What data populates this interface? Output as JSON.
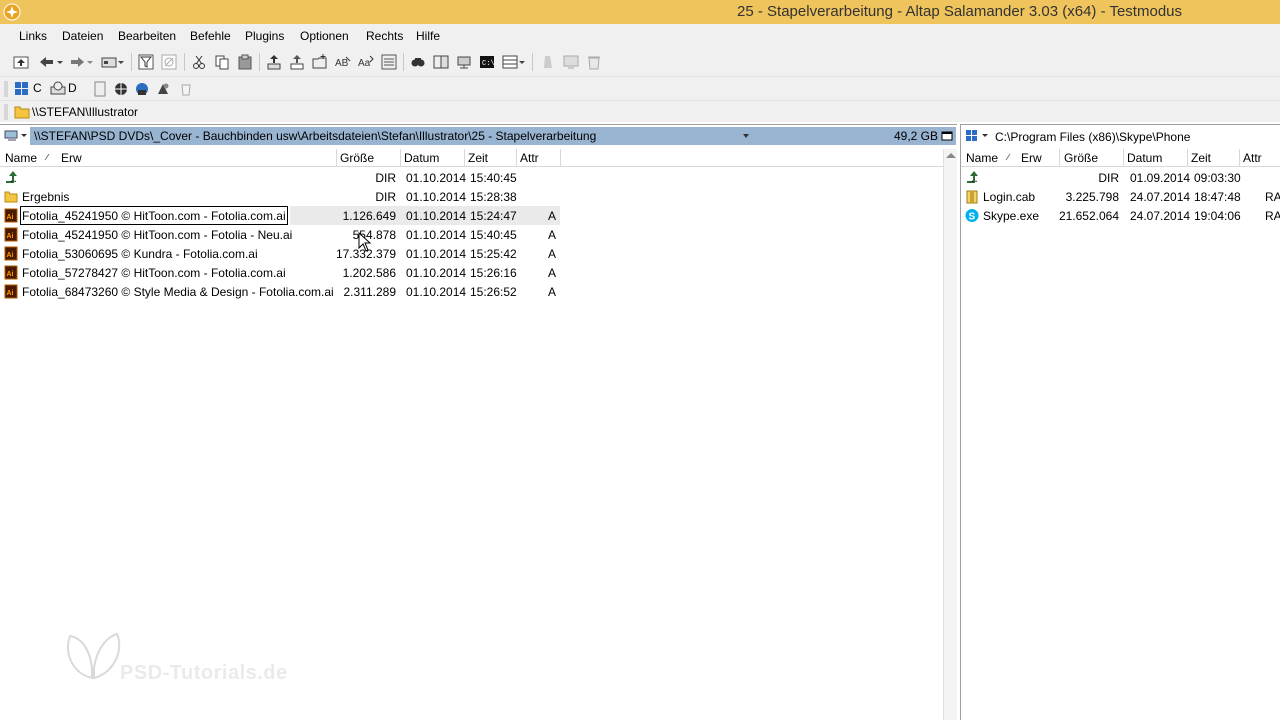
{
  "window": {
    "title": "25 - Stapelverarbeitung - Altap Salamander 3.03 (x64) - Testmodus"
  },
  "menu": {
    "items": [
      {
        "label": "Links"
      },
      {
        "label": "Dateien"
      },
      {
        "label": "Bearbeiten"
      },
      {
        "label": "Befehle"
      },
      {
        "label": "Plugins"
      },
      {
        "label": "Optionen"
      },
      {
        "label": "Rechts"
      },
      {
        "label": "Hilfe"
      }
    ]
  },
  "drives": {
    "c": "C",
    "d": "D"
  },
  "hotpath": {
    "label": "\\\\STEFAN\\Illustrator"
  },
  "left_panel": {
    "path": "\\\\STEFAN\\PSD DVDs\\_Cover - Bauchbinden usw\\Arbeitsdateien\\Stefan\\Illustrator\\25 - Stapelverarbeitung",
    "free_space": "49,2 GB",
    "columns": {
      "name": "Name",
      "ext": "Erw",
      "size": "Größe",
      "date": "Datum",
      "time": "Zeit",
      "attr": "Attr"
    },
    "rows": [
      {
        "name": "..",
        "size": "DIR",
        "date": "01.10.2014",
        "time": "15:40:45",
        "attr": "",
        "icon": "up-dir-icon"
      },
      {
        "name": "Ergebnis",
        "size": "DIR",
        "date": "01.10.2014",
        "time": "15:28:38",
        "attr": "",
        "icon": "folder-icon"
      },
      {
        "name": "Fotolia_45241950 © HitToon.com - Fotolia.com.ai",
        "size": "1.126.649",
        "date": "01.10.2014",
        "time": "15:24:47",
        "attr": "A",
        "icon": "illustrator-file-icon"
      },
      {
        "name": "Fotolia_45241950 © HitToon.com - Fotolia - Neu.ai",
        "size": "554.878",
        "date": "01.10.2014",
        "time": "15:40:45",
        "attr": "A",
        "icon": "illustrator-file-icon"
      },
      {
        "name": "Fotolia_53060695 © Kundra - Fotolia.com.ai",
        "size": "17.332.379",
        "date": "01.10.2014",
        "time": "15:25:42",
        "attr": "A",
        "icon": "illustrator-file-icon"
      },
      {
        "name": "Fotolia_57278427 © HitToon.com - Fotolia.com.ai",
        "size": "1.202.586",
        "date": "01.10.2014",
        "time": "15:26:16",
        "attr": "A",
        "icon": "illustrator-file-icon"
      },
      {
        "name": "Fotolia_68473260 © Style Media & Design - Fotolia.com.ai",
        "size": "2.311.289",
        "date": "01.10.2014",
        "time": "15:26:52",
        "attr": "A",
        "icon": "illustrator-file-icon"
      }
    ]
  },
  "right_panel": {
    "path": "C:\\Program Files (x86)\\Skype\\Phone",
    "columns": {
      "name": "Name",
      "ext": "Erw",
      "size": "Größe",
      "date": "Datum",
      "time": "Zeit",
      "attr": "Attr"
    },
    "rows": [
      {
        "name": "..",
        "size": "DIR",
        "date": "01.09.2014",
        "time": "09:03:30",
        "attr": "",
        "icon": "up-dir-icon"
      },
      {
        "name": "Login.cab",
        "size": "3.225.798",
        "date": "24.07.2014",
        "time": "18:47:48",
        "attr": "RA",
        "icon": "cab-file-icon"
      },
      {
        "name": "Skype.exe",
        "size": "21.652.064",
        "date": "24.07.2014",
        "time": "19:04:06",
        "attr": "RA",
        "icon": "skype-icon"
      }
    ]
  },
  "watermark": {
    "text": "PSD-Tutorials.de"
  },
  "colors": {
    "title_bar": "#f0c45c",
    "path_highlight": "#99b4d1"
  }
}
